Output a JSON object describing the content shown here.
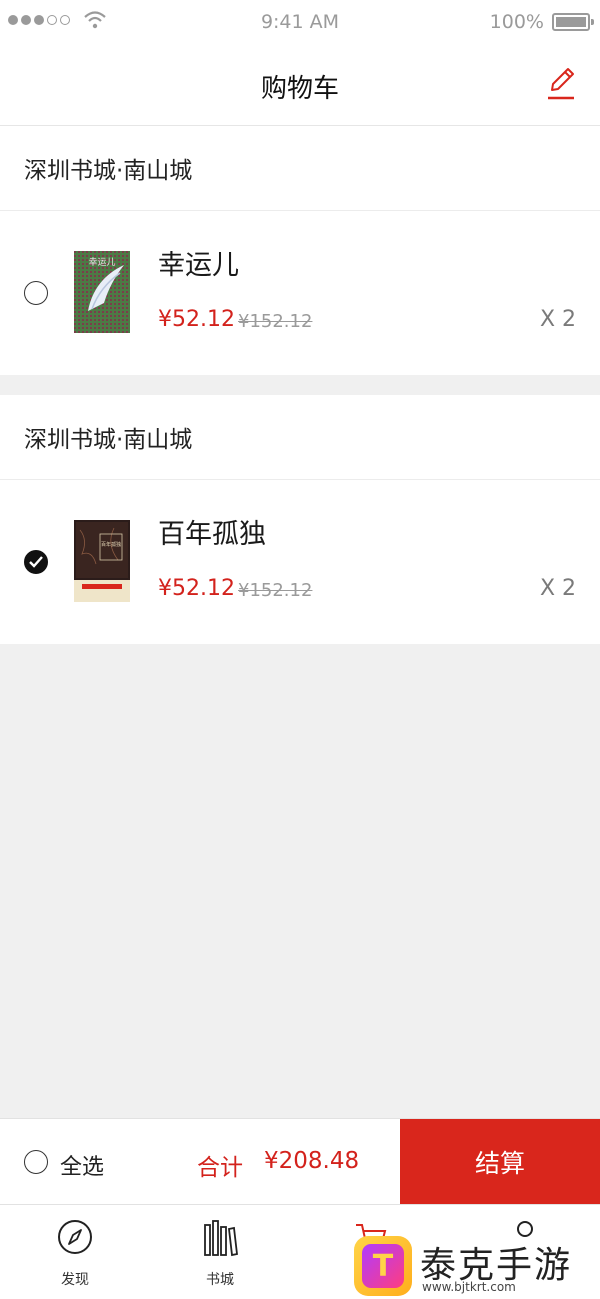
{
  "status_bar": {
    "time": "9:41 AM",
    "battery": "100%"
  },
  "nav": {
    "title": "购物车",
    "edit_icon": "pencil-edit-icon"
  },
  "stores": [
    {
      "name": "深圳书城·南山城",
      "items": [
        {
          "title": "幸运儿",
          "cover_text": "幸运儿",
          "price": "¥52.12",
          "original_price": "¥152.12",
          "quantity": "X 2",
          "checked": false
        }
      ]
    },
    {
      "name": "深圳书城·南山城",
      "items": [
        {
          "title": "百年孤独",
          "cover_text": "百年孤独",
          "price": "¥52.12",
          "original_price": "¥152.12",
          "quantity": "X 2",
          "checked": true
        }
      ]
    }
  ],
  "checkout": {
    "select_all": "全选",
    "total_label": "合计",
    "total_value": "¥208.48",
    "checkout_label": "结算"
  },
  "tabs": [
    {
      "label": "发现",
      "icon": "compass-icon"
    },
    {
      "label": "书城",
      "icon": "bookshelf-icon"
    },
    {
      "label": "",
      "icon": "cart-icon"
    },
    {
      "label": "",
      "icon": "user-icon"
    }
  ],
  "watermark": {
    "title": "泰克手游网",
    "url": "www.bjtkrt.com"
  },
  "colors": {
    "accent": "#d9261c",
    "price": "#d3221c",
    "background": "#f0f0f0"
  }
}
